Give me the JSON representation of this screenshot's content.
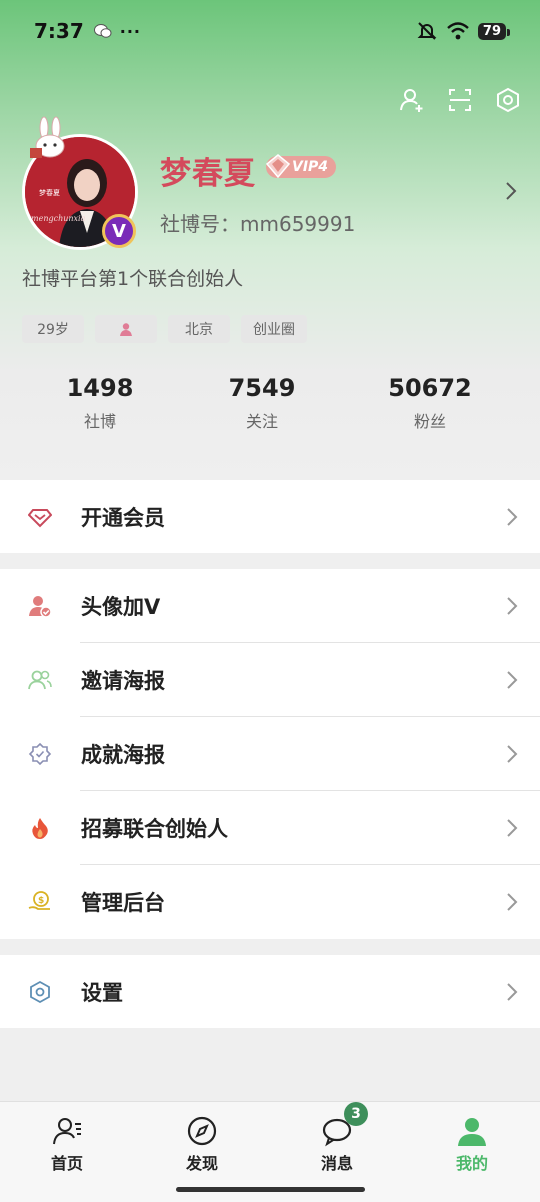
{
  "status": {
    "time": "7:37",
    "dots": "···",
    "battery": "79"
  },
  "profile": {
    "name": "梦春夏",
    "vip_label": "VIP4",
    "id_label": "社博号：mm659991",
    "bio": "社博平台第1个联合创始人",
    "avatar_text": "mengchunxia",
    "vbadge": "V",
    "tags": [
      "29岁",
      "",
      "北京",
      "创业圈"
    ]
  },
  "stats": [
    {
      "value": "1498",
      "label": "社博"
    },
    {
      "value": "7549",
      "label": "关注"
    },
    {
      "value": "50672",
      "label": "粉丝"
    }
  ],
  "menu": {
    "membership": "开通会员",
    "avatar_v": "头像加V",
    "invite_poster": "邀请海报",
    "achievement_poster": "成就海报",
    "recruit": "招募联合创始人",
    "admin": "管理后台",
    "settings": "设置"
  },
  "tabbar": {
    "home": "首页",
    "discover": "发现",
    "messages": "消息",
    "messages_badge": "3",
    "mine": "我的"
  },
  "colors": {
    "accent": "#4cb86a",
    "name": "#d44a5c",
    "header_top": "#6cc57a"
  }
}
